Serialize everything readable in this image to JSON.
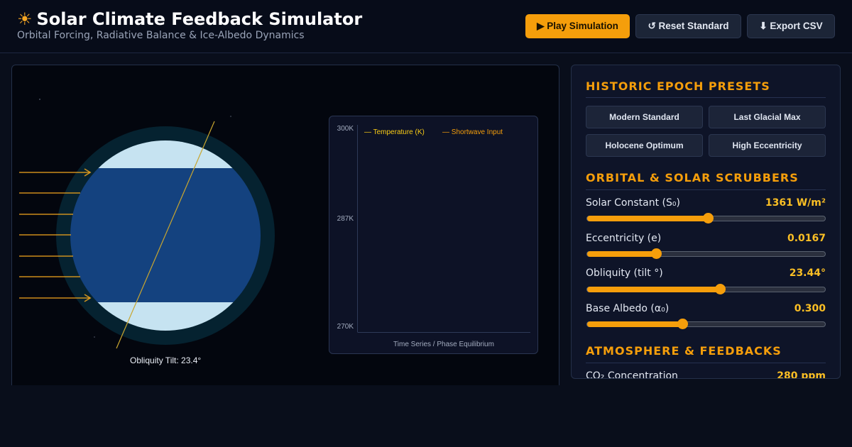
{
  "header": {
    "title": "Solar Climate Feedback Simulator",
    "subtitle": "Orbital Forcing, Radiative Balance & Ice-Albedo Dynamics",
    "sun_icon": "☀",
    "play_label": "▶ Play Simulation",
    "reset_label": "↺ Reset Standard",
    "export_label": "⬇ Export CSV"
  },
  "visual": {
    "tilt_label": "Obliquity Tilt: 23.4°",
    "chart": {
      "y_ticks": [
        "300K",
        "287K",
        "270K"
      ],
      "legend_temperature": "— Temperature (K)",
      "legend_shortwave": "— Shortwave Input",
      "xlabel": "Time Series / Phase Equilibrium"
    }
  },
  "presets": {
    "title": "HISTORIC EPOCH PRESETS",
    "items": [
      "Modern Standard",
      "Last Glacial Max",
      "Holocene Optimum",
      "High Eccentricity"
    ]
  },
  "orbital": {
    "title": "ORBITAL & SOLAR SCRUBBERS",
    "sliders": [
      {
        "label": "Solar Constant (S₀)",
        "value": "1361 W/m²",
        "fraction": 0.51
      },
      {
        "label": "Eccentricity (e)",
        "value": "0.0167",
        "fraction": 0.29
      },
      {
        "label": "Obliquity (tilt °)",
        "value": "23.44°",
        "fraction": 0.56
      },
      {
        "label": "Base Albedo (α₀)",
        "value": "0.300",
        "fraction": 0.4
      }
    ]
  },
  "atmosphere": {
    "title": "ATMOSPHERE & FEEDBACKS",
    "sliders": [
      {
        "label": "CO₂ Concentration",
        "value": "280 ppm"
      }
    ]
  },
  "colors": {
    "accent": "#f59e0b",
    "value_text": "#fbbf24",
    "ocean": "#14427f",
    "ice": "#c6e3f1",
    "atmosphere_halo": "#052230",
    "temperature_line": "#facc15",
    "shortwave_line": "#f59e0b"
  }
}
